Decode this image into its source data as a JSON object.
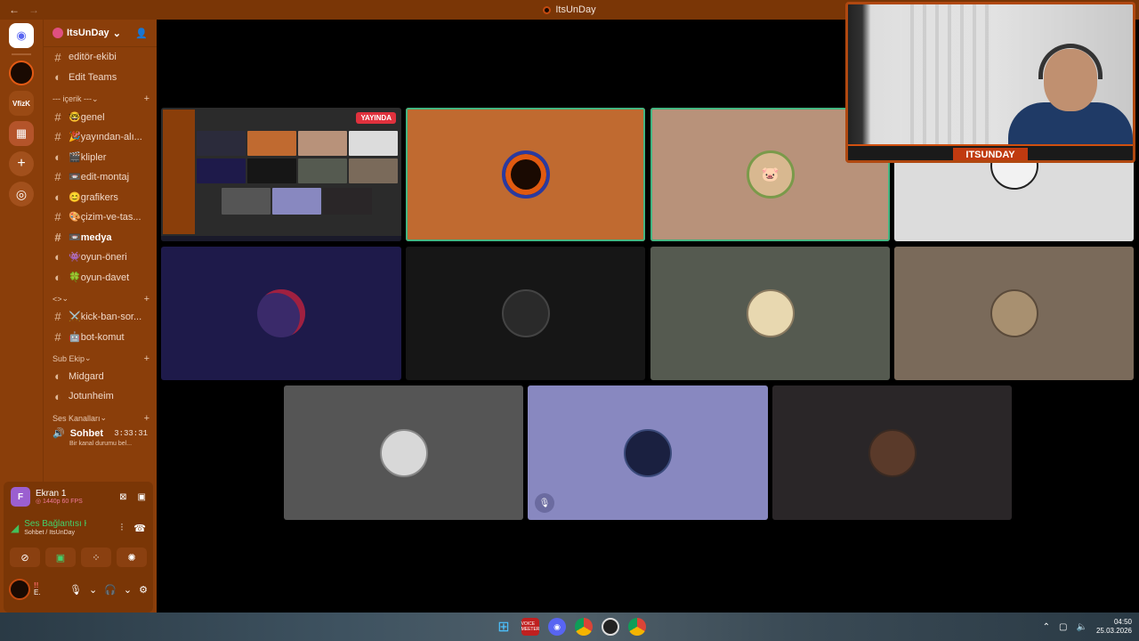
{
  "window": {
    "title": "ItsUnDay",
    "back_icon": "←",
    "forward_icon": "→"
  },
  "server": {
    "name": "ItsUnDay"
  },
  "rail": {
    "vfz_label": "VfizK"
  },
  "channels_top": [
    {
      "name": "editör-ekibi",
      "type": "text"
    },
    {
      "name": "Edit Teams",
      "type": "forum"
    }
  ],
  "category_icerik": "--- içerik ---",
  "channels_icerik": [
    {
      "name": "🤓genel"
    },
    {
      "name": "🎉yayından-alı..."
    },
    {
      "name": "🎬klipler"
    },
    {
      "name": "📼edit-montaj"
    },
    {
      "name": "😊grafikers"
    },
    {
      "name": "🎨çizim-ve-tas..."
    },
    {
      "name": "📼medya",
      "active": true
    },
    {
      "name": "👾oyun-öneri"
    },
    {
      "name": "🍀oyun-davet"
    }
  ],
  "category_misc": "<>",
  "channels_misc": [
    {
      "name": "⚔️kick-ban-sor..."
    },
    {
      "name": "🤖bot-komut"
    }
  ],
  "category_sub": "Sub Ekip",
  "channels_sub": [
    {
      "name": "Midgard"
    },
    {
      "name": "Jotunheim"
    }
  ],
  "category_voice": "Ses Kanalları",
  "voice_channel": {
    "name": "Sohbet",
    "timer": "3:33:31",
    "status": "Bir kanal durumu bel..."
  },
  "panel": {
    "stream": {
      "badge": "F",
      "name": "Ekran 1",
      "meta": "◎ 1440p 60 FPS"
    },
    "connection": {
      "title": "Ses Bağlantısı Kuruldu",
      "subtitle": "Sohbet / ItsUnDay"
    },
    "user": {
      "line1": "!!",
      "line2": "E."
    }
  },
  "stage": {
    "live_badge": "YAYINDA",
    "webcam_name": "ITSUNDAY"
  },
  "taskbar": {
    "voice_label": "VOICE MEETER",
    "time": "04:50",
    "date": "25.03.2026"
  },
  "colors": {
    "brand": "#7a3606",
    "sidebar": "#8a3e0a",
    "speaking": "#43b581",
    "live": "#e0313d"
  }
}
